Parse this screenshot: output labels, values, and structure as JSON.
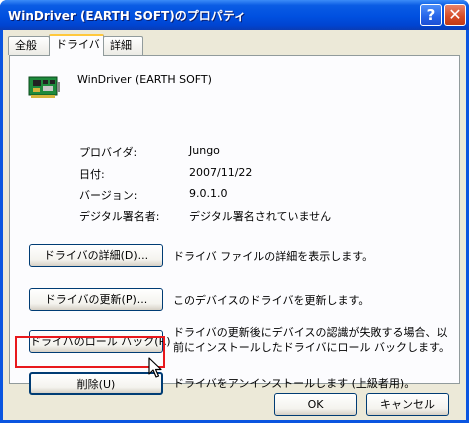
{
  "window": {
    "title": "WinDriver (EARTH SOFT)のプロパティ",
    "help_glyph": "?",
    "close_glyph": "✕"
  },
  "tabs": [
    {
      "label": "全般",
      "selected": false
    },
    {
      "label": "ドライバ",
      "selected": true
    },
    {
      "label": "詳細",
      "selected": false
    }
  ],
  "device": {
    "icon": "circuit-board-icon",
    "name": "WinDriver (EARTH SOFT)"
  },
  "properties": [
    {
      "label": "プロバイダ:",
      "value": "Jungo"
    },
    {
      "label": "日付:",
      "value": "2007/11/22"
    },
    {
      "label": "バージョン:",
      "value": "9.0.1.0"
    },
    {
      "label": "デジタル署名者:",
      "value": "デジタル署名されていません"
    }
  ],
  "actions": {
    "details": {
      "label": "ドライバの詳細(D)...",
      "description": "ドライバ ファイルの詳細を表示します。"
    },
    "update": {
      "label": "ドライバの更新(P)...",
      "description": "このデバイスのドライバを更新します。"
    },
    "rollback": {
      "label": "ドライバのロール バック(R)",
      "description_line1": "ドライバの更新後にデバイスの認識が失敗する場合、以",
      "description_line2": "前にインストールしたドライバにロール バックします。"
    },
    "uninstall": {
      "label": "削除(U)",
      "description": "ドライバをアンインストールします (上級者用)。"
    }
  },
  "footer": {
    "ok_label": "OK",
    "cancel_label": "キャンセル"
  },
  "colors": {
    "titlebar": "#0054e3",
    "dialog_bg": "#ece9d8",
    "highlight_frame": "#e8181c",
    "selected_tab_accent": "#ffc83c"
  }
}
